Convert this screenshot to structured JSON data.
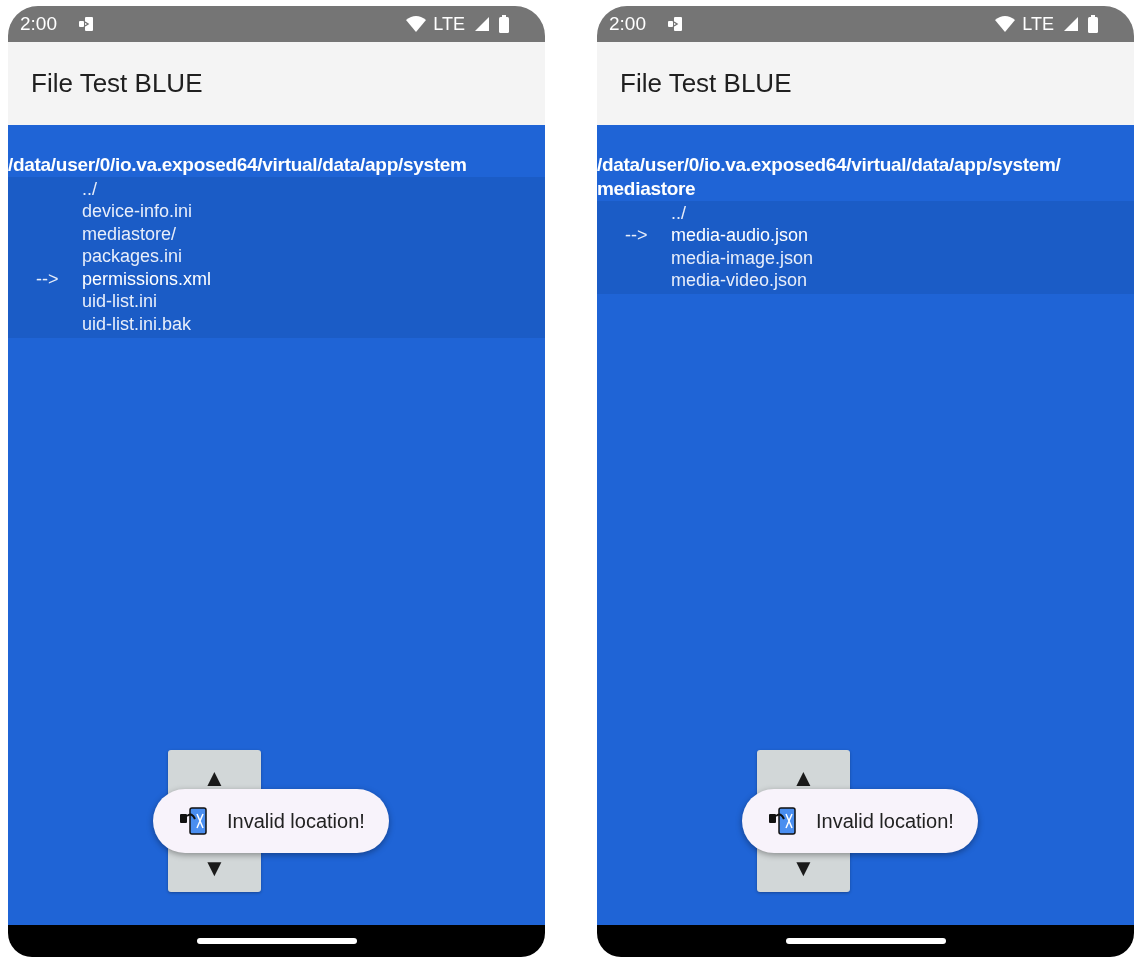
{
  "screens": [
    {
      "status_bar": {
        "time": "2:00",
        "network": "LTE"
      },
      "app_bar": {
        "title": "File Test BLUE"
      },
      "path": "/data/user/0/io.va.exposed64/virtual/data/app/system",
      "cursor": "-->",
      "entries": [
        {
          "name": "../",
          "selected": false
        },
        {
          "name": "device-info.ini",
          "selected": false
        },
        {
          "name": "mediastore/",
          "selected": false
        },
        {
          "name": "packages.ini",
          "selected": false
        },
        {
          "name": "permissions.xml",
          "selected": true
        },
        {
          "name": "uid-list.ini",
          "selected": false
        },
        {
          "name": "uid-list.ini.bak",
          "selected": false
        }
      ],
      "stepper": {
        "up": "▲",
        "down": "▼"
      },
      "toast": {
        "message": "Invalid location!"
      }
    },
    {
      "status_bar": {
        "time": "2:00",
        "network": "LTE"
      },
      "app_bar": {
        "title": "File Test BLUE"
      },
      "path": "/data/user/0/io.va.exposed64/virtual/data/app/system/mediastore",
      "cursor": "-->",
      "entries": [
        {
          "name": "../",
          "selected": false
        },
        {
          "name": "media-audio.json",
          "selected": true
        },
        {
          "name": "media-image.json",
          "selected": false
        },
        {
          "name": "media-video.json",
          "selected": false
        }
      ],
      "stepper": {
        "up": "▲",
        "down": "▼"
      },
      "toast": {
        "message": "Invalid location!"
      }
    }
  ]
}
